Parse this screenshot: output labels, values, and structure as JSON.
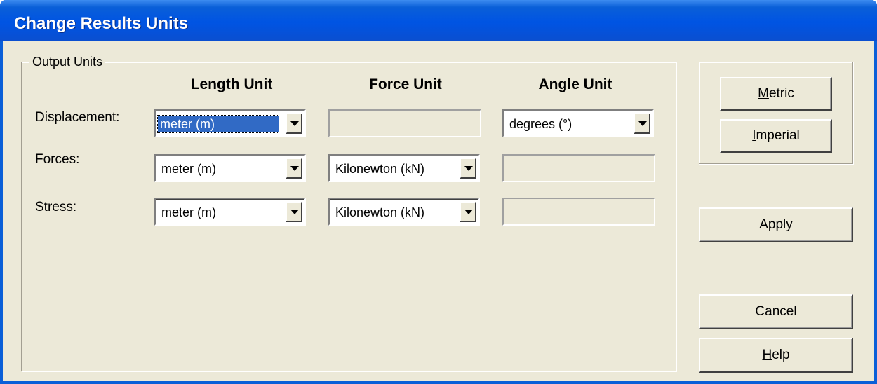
{
  "window": {
    "title": "Change Results Units"
  },
  "group": {
    "legend": "Output Units"
  },
  "columns": {
    "length": "Length Unit",
    "force": "Force Unit",
    "angle": "Angle Unit"
  },
  "rows": {
    "displacement": {
      "label": "Displacement:",
      "length_value": "meter (m)",
      "angle_value": "degrees (°)"
    },
    "forces": {
      "label": "Forces:",
      "length_value": "meter (m)",
      "force_value": "Kilonewton (kN)"
    },
    "stress": {
      "label": "Stress:",
      "length_value": "meter (m)",
      "force_value": "Kilonewton (kN)"
    }
  },
  "buttons": {
    "metric": {
      "mnemonic": "M",
      "rest": "etric"
    },
    "imperial": {
      "mnemonic": "I",
      "rest": "mperial"
    },
    "apply": "Apply",
    "cancel": "Cancel",
    "help": {
      "mnemonic": "H",
      "rest": "elp"
    }
  },
  "colors": {
    "title_bar": "#0054e3",
    "dialog_bg": "#ece9d8",
    "selection": "#316ac5"
  }
}
